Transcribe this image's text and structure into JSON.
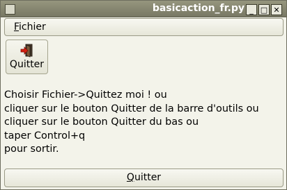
{
  "window": {
    "title": "basicaction_fr.py",
    "minimize_glyph": "_",
    "maximize_glyph": "□",
    "close_glyph": "✕"
  },
  "menubar": {
    "items": [
      {
        "mnemonic": "F",
        "rest": "ichier"
      }
    ]
  },
  "toolbar": {
    "quit_label": "Quitter",
    "quit_icon": "exit-door-icon"
  },
  "message": {
    "lines": [
      "Choisir Fichier->Quittez moi ! ou",
      "cliquer sur le bouton Quitter de la barre d'outils ou",
      "cliquer sur le bouton Quitter du bas ou",
      "taper Control+q",
      "pour sortir."
    ]
  },
  "bottom_button": {
    "mnemonic": "Q",
    "rest": "uitter"
  }
}
